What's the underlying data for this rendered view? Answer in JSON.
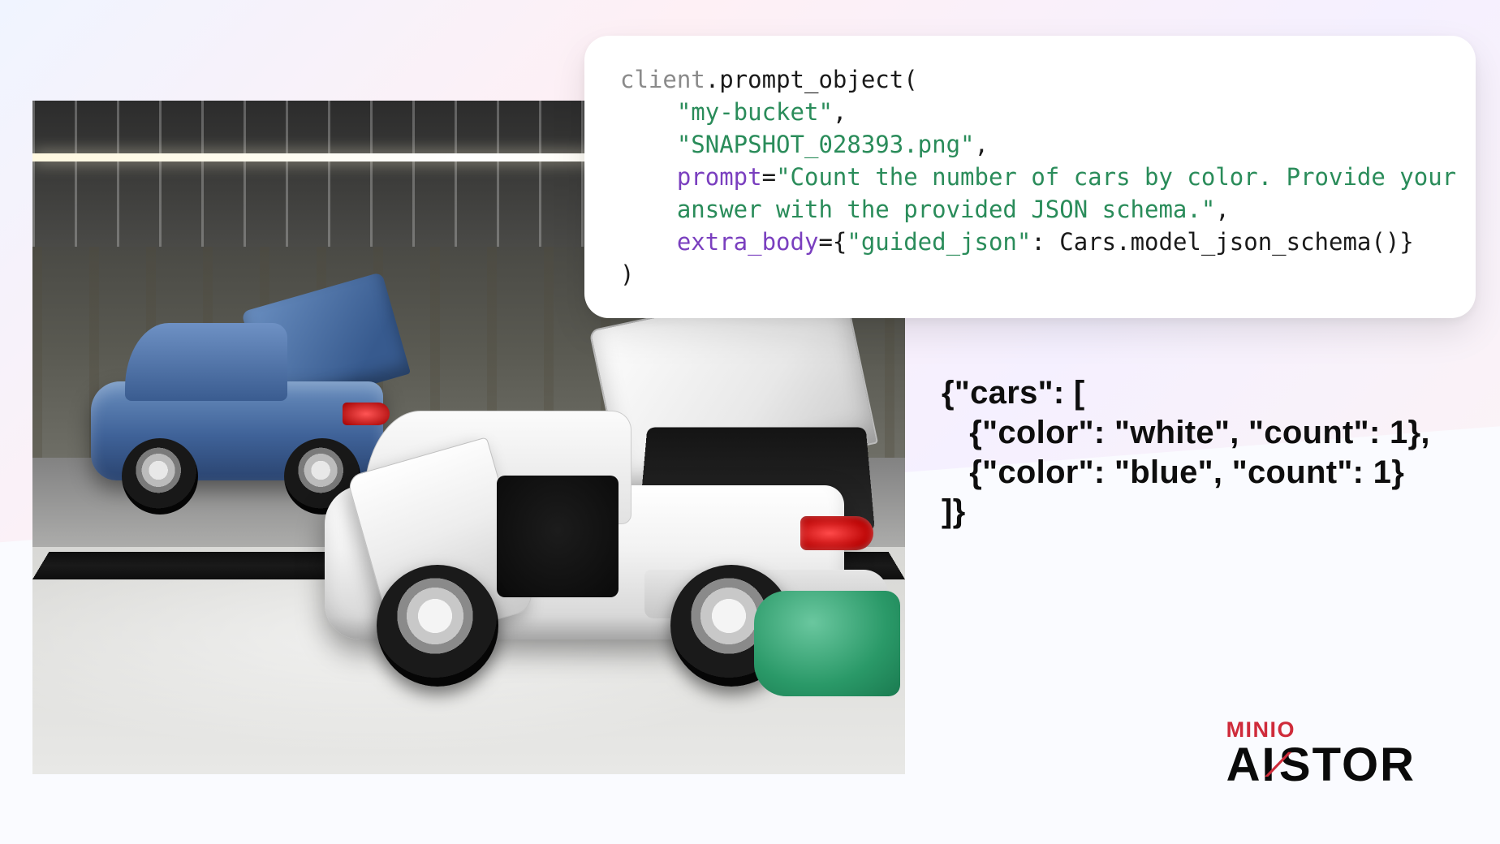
{
  "code": {
    "object": "client",
    "method": ".prompt_object(",
    "arg_bucket": "\"my-bucket\"",
    "arg_file": "\"SNAPSHOT_028393.png\"",
    "kw_prompt": "prompt",
    "val_prompt_l1": "\"Count the number of cars by color. Provide your",
    "val_prompt_l2": "answer with the provided JSON schema.\"",
    "kw_extra": "extra_body",
    "brace_open": "={",
    "key_guided": "\"guided_json\"",
    "colon_space": ": ",
    "val_schema": "Cars.model_json_schema()}",
    "close": ")",
    "comma": ",",
    "eq": "="
  },
  "output": {
    "l1": "{\"cars\": [",
    "l2": "   {\"color\": \"white\", \"count\": 1},",
    "l3": "   {\"color\": \"blue\", \"count\": 1}",
    "l4": "]}"
  },
  "logo": {
    "top": "MINIO",
    "main_a": "AI",
    "main_b": "STOR"
  },
  "image_alt": "Car factory assembly line with a white sedan and a blue sedan, trunks and doors open"
}
